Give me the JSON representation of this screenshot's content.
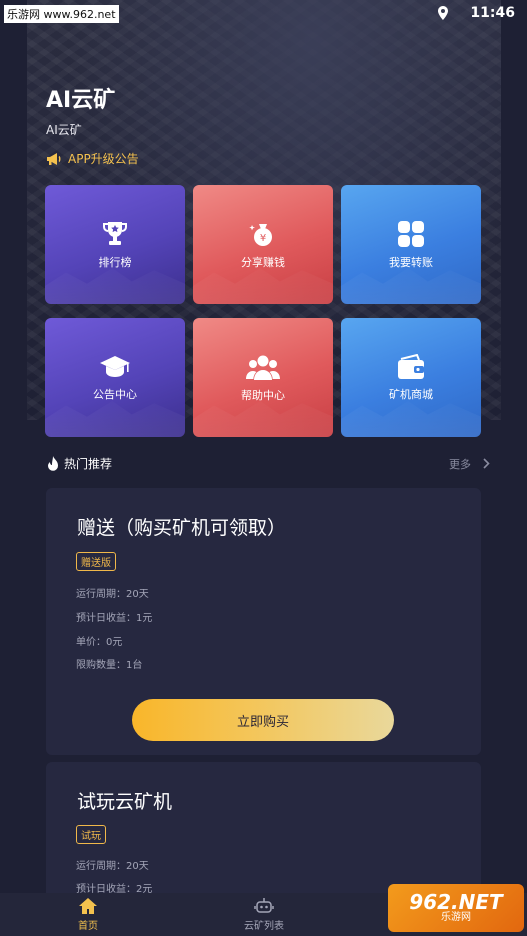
{
  "status": {
    "time": "11:46",
    "watermark": "乐游网 www.962.net"
  },
  "header": {
    "title": "AI云矿",
    "subtitle": "AI云矿",
    "notice": "APP升级公告"
  },
  "grid": {
    "tiles": [
      {
        "label": "排行榜",
        "icon": "trophy-icon"
      },
      {
        "label": "分享赚钱",
        "icon": "money-bag-icon"
      },
      {
        "label": "我要转账",
        "icon": "apps-icon"
      },
      {
        "label": "公告中心",
        "icon": "graduation-cap-icon"
      },
      {
        "label": "帮助中心",
        "icon": "users-icon"
      },
      {
        "label": "矿机商城",
        "icon": "wallet-icon"
      }
    ]
  },
  "section": {
    "title": "热门推荐",
    "more": "更多"
  },
  "products": [
    {
      "title": "赠送（购买矿机可领取）",
      "tag": "赠送版",
      "cycle": "运行周期：20天",
      "daily": "预计日收益：1元",
      "price": "单价：0元",
      "limit": "限购数量：1台",
      "button": "立即购买"
    },
    {
      "title": "试玩云矿机",
      "tag": "试玩",
      "cycle": "运行周期：20天",
      "daily": "预计日收益：2元"
    }
  ],
  "tabbar": {
    "home": "首页",
    "list": "云矿列表"
  },
  "watermark_bottom": {
    "big": "962.NET",
    "small": "乐游网"
  },
  "colors": {
    "accent": "#f3c14e",
    "purple": "#5444b8",
    "red": "#e05a5c",
    "blue": "#3b7fe0",
    "bg": "#1e2034"
  }
}
